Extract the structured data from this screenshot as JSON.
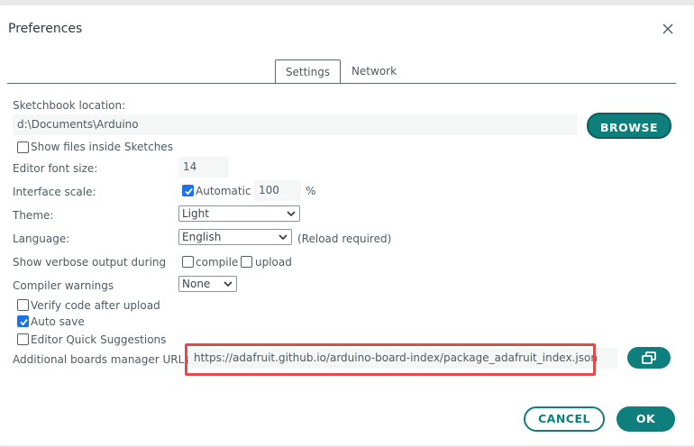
{
  "dialog": {
    "title": "Preferences"
  },
  "tabs": [
    {
      "label": "Settings",
      "active": true
    },
    {
      "label": "Network",
      "active": false
    }
  ],
  "sketchbook": {
    "label": "Sketchbook location:",
    "value": "d:\\Documents\\Arduino",
    "browse_label": "BROWSE",
    "show_files_label": "Show files inside Sketches",
    "show_files_checked": false
  },
  "editor_font": {
    "label": "Editor font size:",
    "value": "14"
  },
  "interface_scale": {
    "label": "Interface scale:",
    "automatic_label": "Automatic",
    "automatic_checked": true,
    "value": "100",
    "unit": "%"
  },
  "theme": {
    "label": "Theme:",
    "selected": "Light"
  },
  "language": {
    "label": "Language:",
    "selected": "English",
    "note": "(Reload required)"
  },
  "verbose": {
    "label": "Show verbose output during",
    "compile_label": "compile",
    "compile_checked": false,
    "upload_label": "upload",
    "upload_checked": false
  },
  "compiler_warnings": {
    "label": "Compiler warnings",
    "selected": "None"
  },
  "options": {
    "verify_label": "Verify code after upload",
    "verify_checked": false,
    "autosave_label": "Auto save",
    "autosave_checked": true,
    "quick_suggestions_label": "Editor Quick Suggestions",
    "quick_suggestions_checked": false
  },
  "boards_manager": {
    "label": "Additional boards manager URLs:",
    "value": "https://adafruit.github.io/arduino-board-index/package_adafruit_index.json"
  },
  "footer": {
    "cancel_label": "CANCEL",
    "ok_label": "OK"
  },
  "colors": {
    "accent": "#0f7f7d",
    "highlight": "#e8474a",
    "checkbox": "#1a73e8"
  },
  "icons": {
    "close": "close-icon",
    "expand_urls": "open-window-icon",
    "dropdown": "chevron-down-icon",
    "check": "check-icon"
  }
}
